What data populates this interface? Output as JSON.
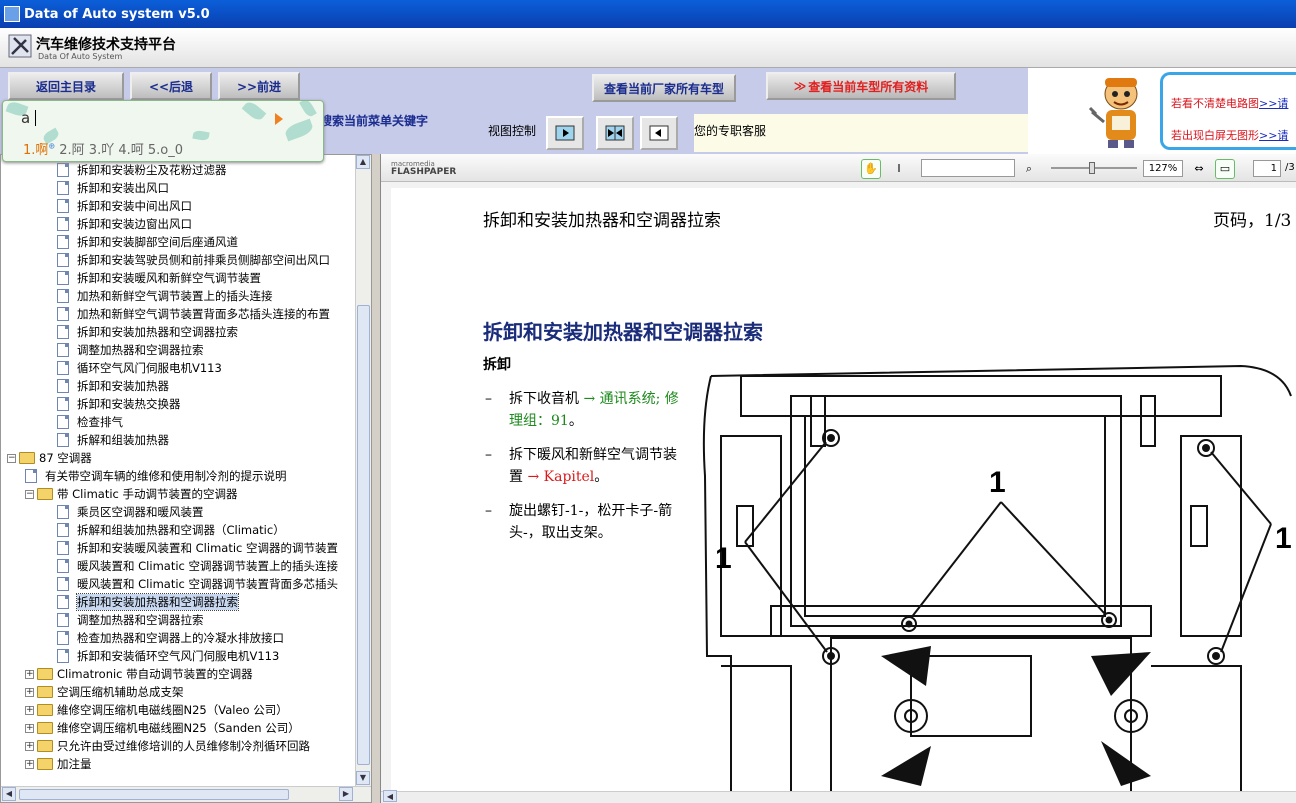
{
  "window": {
    "title": "Data of Auto system v5.0"
  },
  "header": {
    "title": "汽车维修技术支持平台",
    "subtitle": "Data Of Auto System"
  },
  "toolbar": {
    "home": "返回主目录",
    "back": "<<后退",
    "forward": ">>前进",
    "all_models": "查看当前厂家所有车型",
    "all_data": "查看当前车型所有资料"
  },
  "rowbar": {
    "search_hint": "搜索当前菜单关键字",
    "view_label": "视图控制",
    "service": "您的专职客服"
  },
  "ad": {
    "line1": "若看不清楚电路图",
    "line2": "若出现白屏无图形",
    "link": ">>请"
  },
  "ime": {
    "typed": "a",
    "candidates": [
      "1.啊",
      "2.阿",
      "3.吖",
      "4.呵",
      "5.o_0"
    ]
  },
  "tree": {
    "items": [
      {
        "label": "拆卸和安装粉尘及花粉过滤器",
        "level": 3,
        "type": "doc"
      },
      {
        "label": "拆卸和安装出风口",
        "level": 3,
        "type": "doc"
      },
      {
        "label": "拆卸和安装中间出风口",
        "level": 3,
        "type": "doc"
      },
      {
        "label": "拆卸和安装边窗出风口",
        "level": 3,
        "type": "doc"
      },
      {
        "label": "拆卸和安装脚部空间后座通风道",
        "level": 3,
        "type": "doc"
      },
      {
        "label": "拆卸和安装驾驶员侧和前排乘员侧脚部空间出风口",
        "level": 3,
        "type": "doc"
      },
      {
        "label": "拆卸和安装暖风和新鲜空气调节装置",
        "level": 3,
        "type": "doc"
      },
      {
        "label": "加热和新鲜空气调节装置上的插头连接",
        "level": 3,
        "type": "doc"
      },
      {
        "label": "加热和新鲜空气调节装置背面多芯插头连接的布置",
        "level": 3,
        "type": "doc"
      },
      {
        "label": "拆卸和安装加热器和空调器拉索",
        "level": 3,
        "type": "doc"
      },
      {
        "label": "调整加热器和空调器拉索",
        "level": 3,
        "type": "doc"
      },
      {
        "label": "循环空气风门伺服电机V113",
        "level": 3,
        "type": "doc"
      },
      {
        "label": "拆卸和安装加热器",
        "level": 3,
        "type": "doc"
      },
      {
        "label": "拆卸和安装热交换器",
        "level": 3,
        "type": "doc"
      },
      {
        "label": "检查排气",
        "level": 3,
        "type": "doc"
      },
      {
        "label": "拆解和组装加热器",
        "level": 3,
        "type": "doc"
      },
      {
        "label": "87 空调器",
        "level": 1,
        "type": "folder",
        "expander": "-"
      },
      {
        "label": "有关带空调车辆的维修和使用制冷剂的提示说明",
        "level": 2,
        "type": "doc"
      },
      {
        "label": "带 Climatic 手动调节装置的空调器",
        "level": 2,
        "type": "folder",
        "expander": "-"
      },
      {
        "label": "乘员区空调器和暖风装置",
        "level": 3,
        "type": "doc"
      },
      {
        "label": "拆解和组装加热器和空调器（Climatic）",
        "level": 3,
        "type": "doc"
      },
      {
        "label": "拆卸和安装暖风装置和 Climatic 空调器的调节装置",
        "level": 3,
        "type": "doc"
      },
      {
        "label": "暖风装置和 Climatic 空调器调节装置上的插头连接",
        "level": 3,
        "type": "doc"
      },
      {
        "label": "暖风装置和 Climatic 空调器调节装置背面多芯插头",
        "level": 3,
        "type": "doc"
      },
      {
        "label": "拆卸和安装加热器和空调器拉索",
        "level": 3,
        "type": "doc",
        "selected": true
      },
      {
        "label": "调整加热器和空调器拉索",
        "level": 3,
        "type": "doc"
      },
      {
        "label": "检查加热器和空调器上的冷凝水排放接口",
        "level": 3,
        "type": "doc"
      },
      {
        "label": "拆卸和安装循环空气风门伺服电机V113",
        "level": 3,
        "type": "doc"
      },
      {
        "label": "Climatronic 带自动调节装置的空调器",
        "level": 2,
        "type": "folder",
        "expander": "+"
      },
      {
        "label": "空调压缩机辅助总成支架",
        "level": 2,
        "type": "folder",
        "expander": "+"
      },
      {
        "label": "維修空调压缩机电磁线圈N25（Valeo 公司）",
        "level": 2,
        "type": "folder",
        "expander": "+"
      },
      {
        "label": "维修空调压缩机电磁线圈N25（Sanden 公司）",
        "level": 2,
        "type": "folder",
        "expander": "+"
      },
      {
        "label": "只允许由受过维修培训的人员维修制冷剂循环回路",
        "level": 2,
        "type": "folder",
        "expander": "+"
      },
      {
        "label": "加注量",
        "level": 2,
        "type": "folder",
        "expander": "+"
      }
    ]
  },
  "viewer": {
    "brand_top": "macromedia",
    "brand": "FLASHPAPER",
    "zoom": "127%",
    "page": "1",
    "page_total": "/3"
  },
  "document": {
    "title": "拆卸和安装加热器和空调器拉索",
    "page_label": "页码，1/3",
    "heading": "拆卸和安装加热器和空调器拉索",
    "section": "拆卸",
    "step1_a": "拆下收音机 ",
    "step1_link": "→ 通讯系统; 修理组：91",
    "step1_end": "。",
    "step2_a": "拆下暖风和新鲜空气调节装置 ",
    "step2_link": "→ Kapitel",
    "step2_end": "。",
    "step3": "旋出螺钉-1-，松开卡子-箭头-，取出支架。",
    "callout": "1"
  }
}
